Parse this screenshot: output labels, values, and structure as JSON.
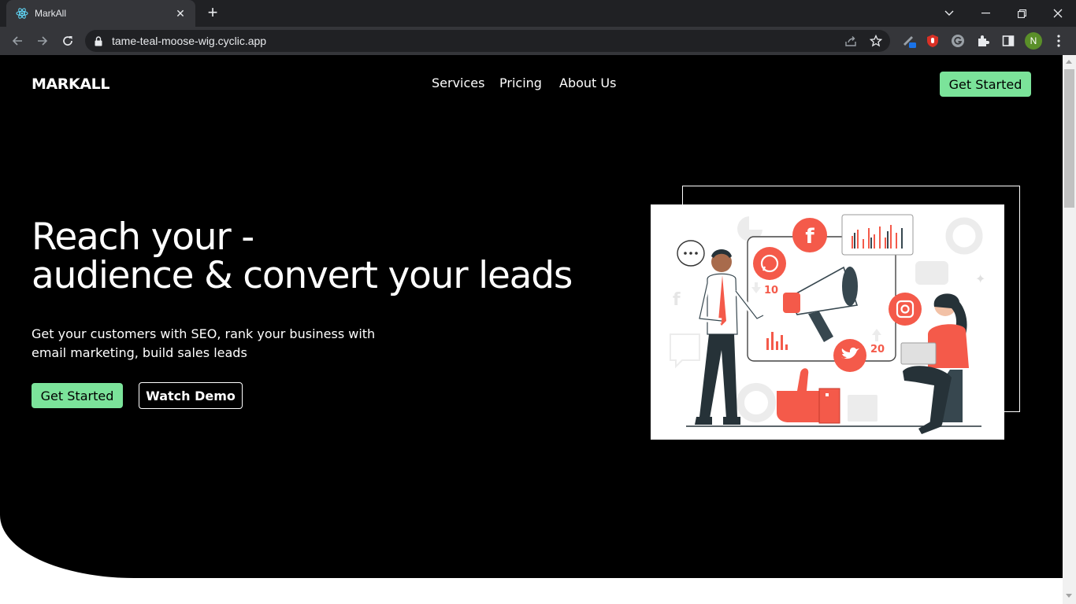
{
  "browser": {
    "tab": {
      "title": "MarkAll",
      "close_glyph": "✕"
    },
    "new_tab_glyph": "+",
    "url": "tame-teal-moose-wig.cyclic.app",
    "profile_initial": "N",
    "colors": {
      "frame": "#202124",
      "toolbar": "#35363a",
      "text": "#e8eaed",
      "profile": "#5a8f29"
    }
  },
  "nav": {
    "logo": "MARKALL",
    "links": [
      "Services",
      "Pricing",
      "About Us"
    ],
    "cta": "Get Started"
  },
  "hero": {
    "headline": [
      "Reach your -",
      "audience & convert your leads"
    ],
    "subtext": "Get your customers with SEO, rank your business with email marketing, build sales leads",
    "primary_button": "Get Started",
    "secondary_button": "Watch Demo",
    "illustration": {
      "bar_labels": [
        "10",
        "20"
      ],
      "icons": [
        "whatsapp-icon",
        "facebook-icon",
        "instagram-icon",
        "twitter-icon",
        "megaphone-icon",
        "thumbs-up-icon",
        "laptop-icon"
      ]
    }
  },
  "colors": {
    "accent": "#7be39a",
    "hero_bg": "#000000",
    "illustration_accent": "#f45a4a"
  }
}
